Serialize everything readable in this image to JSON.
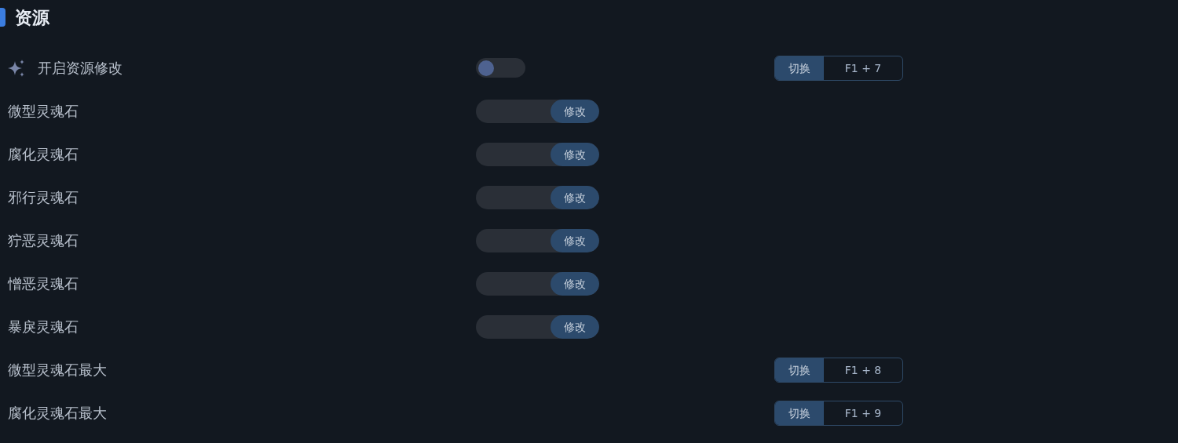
{
  "section": {
    "title": "资源"
  },
  "rows": [
    {
      "kind": "toggle",
      "label": "开启资源修改",
      "icon": true,
      "on": false,
      "hotkey": {
        "button": "切换",
        "keys": "F1 + 7"
      }
    },
    {
      "kind": "input",
      "label": "微型灵魂石",
      "button": "修改"
    },
    {
      "kind": "input",
      "label": "腐化灵魂石",
      "button": "修改"
    },
    {
      "kind": "input",
      "label": "邪行灵魂石",
      "button": "修改"
    },
    {
      "kind": "input",
      "label": "狞恶灵魂石",
      "button": "修改"
    },
    {
      "kind": "input",
      "label": "憎恶灵魂石",
      "button": "修改"
    },
    {
      "kind": "input",
      "label": "暴戾灵魂石",
      "button": "修改"
    },
    {
      "kind": "hotkey",
      "label": "微型灵魂石最大",
      "hotkey": {
        "button": "切换",
        "keys": "F1 + 8"
      }
    },
    {
      "kind": "hotkey",
      "label": "腐化灵魂石最大",
      "hotkey": {
        "button": "切换",
        "keys": "F1 + 9"
      }
    }
  ]
}
